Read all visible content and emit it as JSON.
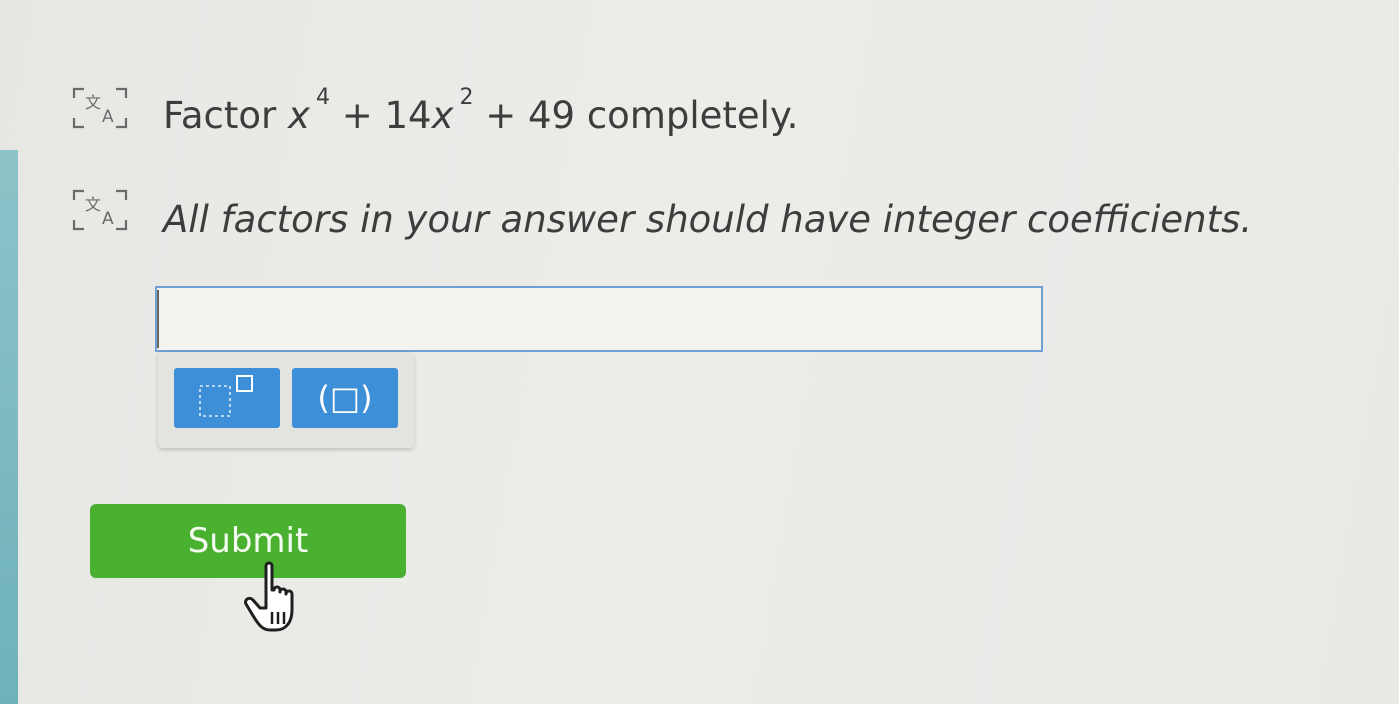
{
  "question": {
    "prefix": "Factor",
    "term1_var": "x",
    "term1_exp": "4",
    "middle": "+ 14",
    "term2_var": "x",
    "term2_exp": "2",
    "suffix": "+ 49 completely."
  },
  "instruction": "All factors in your answer should have integer coefficients.",
  "answer": {
    "value": ""
  },
  "palette": {
    "paren_label": "(□)"
  },
  "submit_label": "Submit",
  "colors": {
    "tool_button": "#3d8fd7",
    "submit_button": "#4ab02f",
    "input_border": "#6fa0cf"
  },
  "icons": {
    "translate": "translate-icon",
    "exponent": "exponent-template-icon",
    "cursor": "hand-pointer-icon"
  }
}
